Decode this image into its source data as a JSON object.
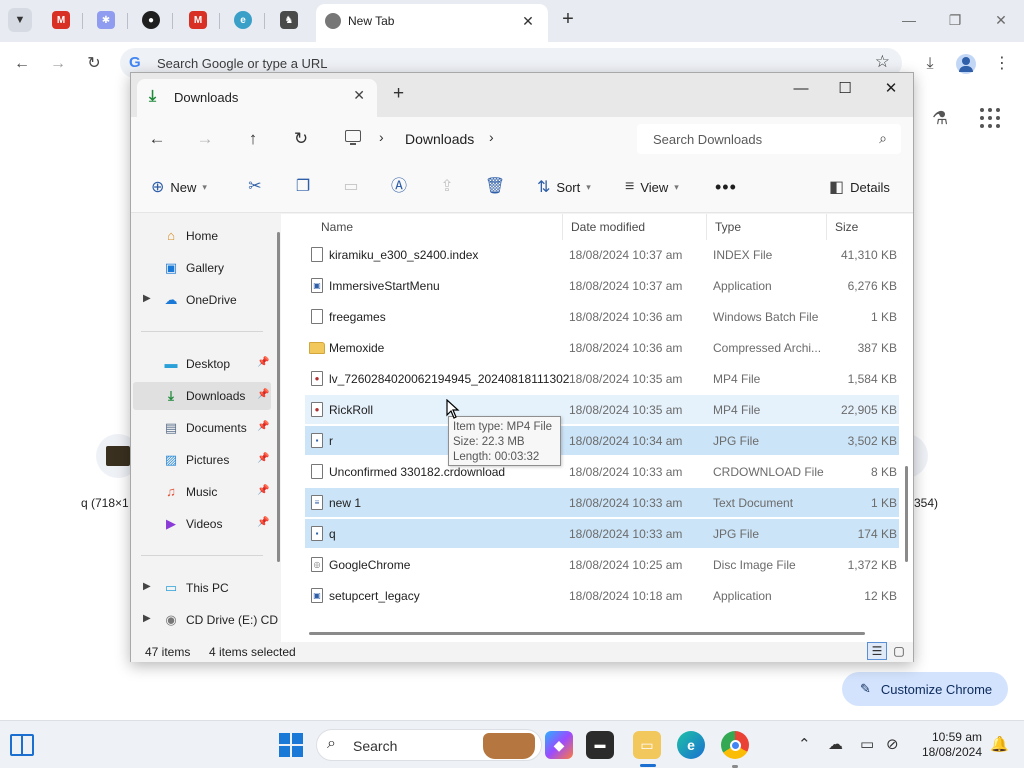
{
  "browser": {
    "tab_title": "New Tab",
    "omnibox_placeholder": "Search Google or type a URL",
    "customize_label": "Customize Chrome",
    "shortcut_left_label": "q (718×1",
    "shortcut_right_label": "354)"
  },
  "explorer": {
    "tab_title": "Downloads",
    "breadcrumb": "Downloads",
    "search_placeholder": "Search Downloads",
    "commands": {
      "new": "New",
      "sort": "Sort",
      "view": "View",
      "details": "Details"
    },
    "nav": [
      {
        "label": "Home",
        "icon": "home-icon"
      },
      {
        "label": "Gallery",
        "icon": "gallery-icon"
      },
      {
        "label": "OneDrive",
        "icon": "cloud-icon"
      },
      {
        "label": "Desktop",
        "icon": "desktop-icon"
      },
      {
        "label": "Downloads",
        "icon": "download-icon"
      },
      {
        "label": "Documents",
        "icon": "documents-icon"
      },
      {
        "label": "Pictures",
        "icon": "pictures-icon"
      },
      {
        "label": "Music",
        "icon": "music-icon"
      },
      {
        "label": "Videos",
        "icon": "videos-icon"
      },
      {
        "label": "This PC",
        "icon": "pc-icon"
      },
      {
        "label": "CD Drive (E:) CD",
        "icon": "cd-drive-icon"
      }
    ],
    "columns": {
      "name": "Name",
      "date": "Date modified",
      "type": "Type",
      "size": "Size"
    },
    "files": [
      {
        "name": "kiramiku_e300_s2400.index",
        "date": "18/08/2024 10:37 am",
        "type": "INDEX File",
        "size": "41,310 KB"
      },
      {
        "name": "ImmersiveStartMenu",
        "date": "18/08/2024 10:37 am",
        "type": "Application",
        "size": "6,276 KB"
      },
      {
        "name": "freegames",
        "date": "18/08/2024 10:36 am",
        "type": "Windows Batch File",
        "size": "1 KB"
      },
      {
        "name": "Memoxide",
        "date": "18/08/2024 10:36 am",
        "type": "Compressed Archi...",
        "size": "387 KB"
      },
      {
        "name": "lv_7260284020062194945_20240818111302",
        "date": "18/08/2024 10:35 am",
        "type": "MP4 File",
        "size": "1,584 KB"
      },
      {
        "name": "RickRoll",
        "date": "18/08/2024 10:35 am",
        "type": "MP4 File",
        "size": "22,905 KB"
      },
      {
        "name": "r",
        "date": "18/08/2024 10:34 am",
        "type": "JPG File",
        "size": "3,502 KB"
      },
      {
        "name": "Unconfirmed 330182.crdownload",
        "date": "18/08/2024 10:33 am",
        "type": "CRDOWNLOAD File",
        "size": "8 KB"
      },
      {
        "name": "new 1",
        "date": "18/08/2024 10:33 am",
        "type": "Text Document",
        "size": "1 KB"
      },
      {
        "name": "q",
        "date": "18/08/2024 10:33 am",
        "type": "JPG File",
        "size": "174 KB"
      },
      {
        "name": "GoogleChrome",
        "date": "18/08/2024 10:25 am",
        "type": "Disc Image File",
        "size": "1,372 KB"
      },
      {
        "name": "setupcert_legacy",
        "date": "18/08/2024 10:18 am",
        "type": "Application",
        "size": "12 KB"
      }
    ],
    "tooltip": {
      "line1": "Item type: MP4 File",
      "line2": "Size: 22.3 MB",
      "line3": "Length: 00:03:32"
    },
    "status": {
      "count": "47 items",
      "selected": "4 items selected"
    }
  },
  "taskbar": {
    "search_label": "Search",
    "time": "10:59 am",
    "date": "18/08/2024"
  },
  "colors": {
    "selection": "#cce4f7",
    "accent": "#1a6fd1"
  }
}
